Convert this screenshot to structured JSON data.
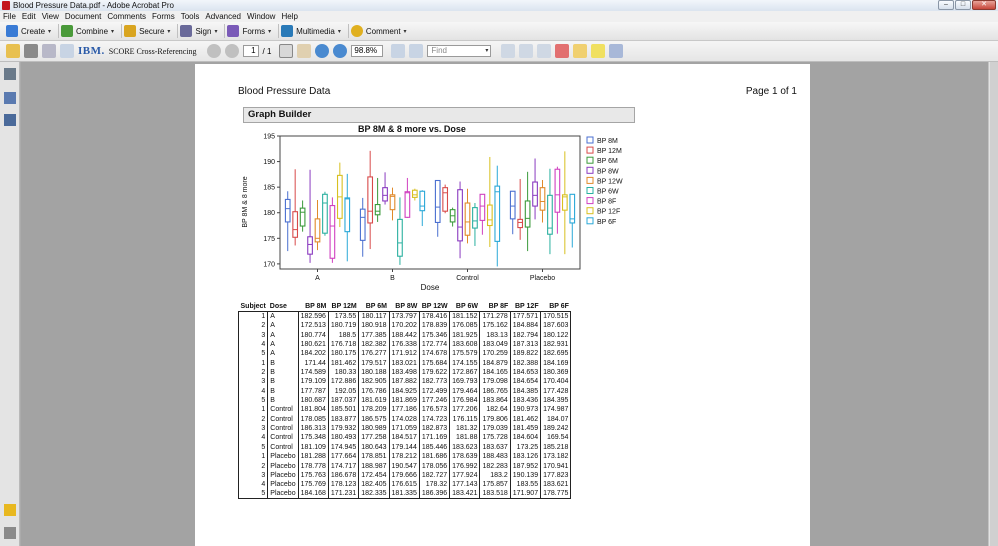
{
  "window": {
    "title": "Blood Pressure Data.pdf - Adobe Acrobat Pro"
  },
  "menu": [
    "File",
    "Edit",
    "View",
    "Document",
    "Comments",
    "Forms",
    "Tools",
    "Advanced",
    "Window",
    "Help"
  ],
  "tasks": [
    {
      "label": "Create",
      "icon": "create-icon",
      "color": "#3a7bd5"
    },
    {
      "label": "Combine",
      "icon": "combine-icon",
      "color": "#4a9a3a"
    },
    {
      "label": "Secure",
      "icon": "secure-lock-icon",
      "color": "#d9a520"
    },
    {
      "label": "Sign",
      "icon": "sign-pen-icon",
      "color": "#6a6a9a"
    },
    {
      "label": "Forms",
      "icon": "forms-icon",
      "color": "#7a5ab8"
    },
    {
      "label": "Multimedia",
      "icon": "multimedia-icon",
      "color": "#2a7ab8"
    },
    {
      "label": "Comment",
      "icon": "comment-icon",
      "color": "#e0b020"
    }
  ],
  "toolbar": {
    "ibm_label": "IBM.",
    "score_label": "SCORE Cross-Referencing",
    "page_current": "1",
    "page_total": "/ 1",
    "zoom": "98.8%",
    "find_placeholder": "Find"
  },
  "document": {
    "report_title": "Blood Pressure Data",
    "page_label": "Page 1 of 1",
    "section_title": "Graph Builder"
  },
  "chart_data": {
    "type": "box",
    "title": "BP 8M & 8 more vs. Dose",
    "xlabel": "Dose",
    "ylabel": "BP 8M & 8 more",
    "ylim": [
      169,
      195
    ],
    "yticks": [
      170,
      175,
      180,
      185,
      190,
      195
    ],
    "categories": [
      "A",
      "B",
      "Control",
      "Placebo"
    ],
    "legend_position": "right",
    "series": [
      {
        "name": "BP 8M",
        "color": "#4a6fd0",
        "boxes": [
          [
            172.5,
            178.2,
            180.8,
            182.6,
            184.2
          ],
          [
            171.4,
            174.6,
            179.1,
            180.7,
            182.9
          ],
          [
            175.3,
            178.1,
            181.1,
            186.3,
            186.3
          ],
          [
            175.8,
            178.8,
            181.3,
            184.2,
            184.2
          ]
        ]
      },
      {
        "name": "BP 12M",
        "color": "#d84a4a",
        "boxes": [
          [
            173.6,
            175.2,
            176.7,
            180.2,
            188.5
          ],
          [
            172.9,
            178.0,
            180.3,
            187.0,
            192.1
          ],
          [
            179.9,
            180.3,
            183.9,
            184.9,
            185.5
          ],
          [
            174.7,
            177.1,
            178.1,
            178.7,
            186.6
          ]
        ]
      },
      {
        "name": "BP 6M",
        "color": "#3a9a3a",
        "boxes": [
          [
            176.3,
            177.4,
            180.1,
            180.9,
            182.4
          ],
          [
            178.2,
            179.6,
            180.3,
            181.6,
            186.8
          ],
          [
            177.3,
            178.2,
            179.4,
            180.6,
            181.0
          ],
          [
            172.5,
            177.2,
            178.9,
            182.3,
            188.0
          ]
        ]
      },
      {
        "name": "BP 8W",
        "color": "#8a3ac0",
        "boxes": [
          [
            170.2,
            171.9,
            173.8,
            175.3,
            188.4
          ],
          [
            181.6,
            182.3,
            183.4,
            184.9,
            187.9
          ],
          [
            171.1,
            174.5,
            177.2,
            184.5,
            186.1
          ],
          [
            178.7,
            181.3,
            183.4,
            186.0,
            190.6
          ]
        ]
      },
      {
        "name": "BP 12W",
        "color": "#e08a2a",
        "boxes": [
          [
            172.7,
            174.3,
            175.0,
            178.8,
            182.5
          ],
          [
            178.5,
            180.6,
            183.2,
            183.5,
            184.9
          ],
          [
            174.0,
            175.6,
            178.2,
            181.9,
            184.7
          ],
          [
            178.1,
            180.5,
            182.2,
            184.9,
            186.4
          ]
        ]
      },
      {
        "name": "BP 6W",
        "color": "#2ab0a0",
        "boxes": [
          [
            175.5,
            176.0,
            181.9,
            183.6,
            184.1
          ],
          [
            169.8,
            171.5,
            174.1,
            178.7,
            183.0
          ],
          [
            173.5,
            177.0,
            178.4,
            181.0,
            181.9
          ],
          [
            171.9,
            175.8,
            177.0,
            183.4,
            188.6
          ]
        ]
      },
      {
        "name": "BP 8F",
        "color": "#d040c0",
        "boxes": [
          [
            170.2,
            171.1,
            177.4,
            181.4,
            183.0
          ],
          [
            179.0,
            179.1,
            183.9,
            184.1,
            186.8
          ],
          [
            175.7,
            178.5,
            181.3,
            183.6,
            183.6
          ],
          [
            175.9,
            180.1,
            183.5,
            188.5,
            189.0
          ]
        ]
      },
      {
        "name": "BP 12F",
        "color": "#d8c020",
        "boxes": [
          [
            177.2,
            178.9,
            183.1,
            187.3,
            189.8
          ],
          [
            182.4,
            183.0,
            183.5,
            184.4,
            184.7
          ],
          [
            173.3,
            177.5,
            178.6,
            181.5,
            190.9
          ],
          [
            171.9,
            180.5,
            183.1,
            183.5,
            192.0
          ]
        ]
      },
      {
        "name": "BP 6F",
        "color": "#2aa8d8",
        "boxes": [
          [
            170.5,
            176.3,
            182.7,
            182.9,
            187.6
          ],
          [
            177.4,
            180.4,
            181.3,
            184.2,
            184.4
          ],
          [
            169.5,
            174.4,
            184.1,
            185.2,
            189.2
          ],
          [
            173.2,
            178.0,
            178.8,
            183.6,
            183.6
          ]
        ]
      }
    ]
  },
  "table": {
    "columns": [
      "Subject",
      "Dose",
      "BP 8M",
      "BP 12M",
      "BP 6M",
      "BP 8W",
      "BP 12W",
      "BP 6W",
      "BP 8F",
      "BP 12F",
      "BP 6F"
    ],
    "rows": [
      [
        "1",
        "A",
        "182.596",
        "173.55",
        "180.117",
        "173.797",
        "178.416",
        "181.152",
        "171.278",
        "177.571",
        "170.515"
      ],
      [
        "2",
        "A",
        "172.513",
        "180.719",
        "180.918",
        "170.202",
        "178.839",
        "176.085",
        "175.162",
        "184.884",
        "187.603"
      ],
      [
        "3",
        "A",
        "180.774",
        "188.5",
        "177.385",
        "188.442",
        "175.346",
        "181.925",
        "183.13",
        "182.794",
        "180.122"
      ],
      [
        "4",
        "A",
        "180.621",
        "176.718",
        "182.382",
        "176.338",
        "172.774",
        "183.608",
        "183.049",
        "187.313",
        "182.931"
      ],
      [
        "5",
        "A",
        "184.202",
        "180.175",
        "176.277",
        "171.912",
        "174.678",
        "175.579",
        "170.259",
        "189.822",
        "182.695"
      ],
      [
        "1",
        "B",
        "171.44",
        "181.462",
        "179.517",
        "183.021",
        "175.684",
        "174.155",
        "184.879",
        "182.388",
        "184.169"
      ],
      [
        "2",
        "B",
        "174.589",
        "180.33",
        "180.188",
        "183.498",
        "179.622",
        "172.867",
        "184.165",
        "184.653",
        "180.369"
      ],
      [
        "3",
        "B",
        "179.109",
        "172.886",
        "182.905",
        "187.882",
        "182.773",
        "169.793",
        "179.098",
        "184.654",
        "170.404"
      ],
      [
        "4",
        "B",
        "177.787",
        "192.05",
        "176.786",
        "184.925",
        "172.499",
        "179.464",
        "186.765",
        "184.385",
        "177.428"
      ],
      [
        "5",
        "B",
        "180.687",
        "187.037",
        "181.619",
        "181.869",
        "177.246",
        "176.984",
        "183.864",
        "183.436",
        "184.395"
      ],
      [
        "1",
        "Control",
        "181.804",
        "185.501",
        "178.209",
        "177.186",
        "176.573",
        "177.206",
        "182.64",
        "190.973",
        "174.987"
      ],
      [
        "2",
        "Control",
        "178.085",
        "183.877",
        "186.575",
        "174.028",
        "174.723",
        "176.115",
        "179.806",
        "181.462",
        "184.07"
      ],
      [
        "3",
        "Control",
        "186.313",
        "179.932",
        "180.989",
        "171.059",
        "182.873",
        "181.32",
        "179.039",
        "181.459",
        "189.242"
      ],
      [
        "4",
        "Control",
        "175.348",
        "180.493",
        "177.258",
        "184.517",
        "171.169",
        "181.88",
        "175.728",
        "184.604",
        "169.54"
      ],
      [
        "5",
        "Control",
        "181.109",
        "174.945",
        "180.643",
        "179.144",
        "185.446",
        "183.623",
        "183.637",
        "173.25",
        "185.218"
      ],
      [
        "1",
        "Placebo",
        "181.288",
        "177.664",
        "178.851",
        "178.212",
        "181.686",
        "178.639",
        "188.483",
        "183.126",
        "173.182"
      ],
      [
        "2",
        "Placebo",
        "178.778",
        "174.717",
        "188.987",
        "190.547",
        "178.056",
        "176.992",
        "182.283",
        "187.952",
        "170.941"
      ],
      [
        "3",
        "Placebo",
        "175.763",
        "186.678",
        "172.454",
        "179.666",
        "182.727",
        "177.924",
        "183.2",
        "190.139",
        "177.823"
      ],
      [
        "4",
        "Placebo",
        "175.769",
        "178.123",
        "182.405",
        "176.615",
        "178.32",
        "177.143",
        "175.857",
        "183.55",
        "183.621"
      ],
      [
        "5",
        "Placebo",
        "184.168",
        "171.231",
        "182.335",
        "181.335",
        "186.396",
        "183.421",
        "183.518",
        "171.907",
        "178.775"
      ]
    ]
  }
}
